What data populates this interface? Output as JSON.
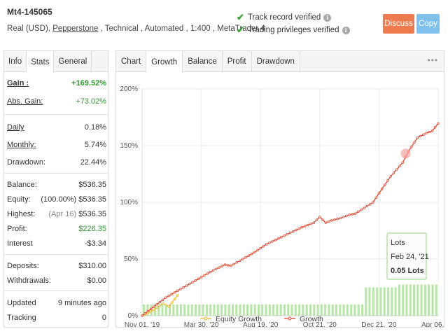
{
  "header": {
    "title": "Mt4-145065",
    "sub_prefix": "Real (USD), ",
    "broker": "Pepperstone",
    "sub_suffix": " , Technical , Automated , 1:400 , MetaTrader 4",
    "verif1": "Track record verified",
    "verif2": "Trading privileges verified",
    "discuss": "Discuss",
    "copy": "Copy",
    "colors": {
      "discuss": "#ee7a4f",
      "copy": "#7fc1ec",
      "check": "#3aa33a"
    }
  },
  "left_tabs": [
    "Info",
    "Stats",
    "General"
  ],
  "stats": {
    "gain": {
      "label": "Gain :",
      "value": "+169.52%"
    },
    "abs_gain": {
      "label": "Abs. Gain:",
      "value": "+73.02%"
    },
    "daily": {
      "label": "Daily",
      "value": "0.18%"
    },
    "monthly": {
      "label": "Monthly:",
      "value": "5.74%"
    },
    "drawdown": {
      "label": "Drawdown:",
      "value": "22.44%"
    },
    "balance": {
      "label": "Balance:",
      "value": "$536.35"
    },
    "equity": {
      "label": "Equity:",
      "note": "(100.00%)",
      "value": "$536.35"
    },
    "highest": {
      "label": "Highest:",
      "note": "(Apr 16)",
      "value": "$536.35"
    },
    "profit": {
      "label": "Profit:",
      "value": "$226.35"
    },
    "interest": {
      "label": "Interest",
      "value": "-$3.34"
    },
    "deposits": {
      "label": "Deposits:",
      "value": "$310.00"
    },
    "withdrawals": {
      "label": "Withdrawals:",
      "value": "$0.00"
    },
    "updated": {
      "label": "Updated",
      "value": "9 minutes ago"
    },
    "tracking": {
      "label": "Tracking",
      "value": "0"
    }
  },
  "right_tabs": [
    "Chart",
    "Growth",
    "Balance",
    "Profit",
    "Drawdown"
  ],
  "more_icon": "ellipsis-icon",
  "chart_data": {
    "type": "line",
    "ylim": [
      0,
      200
    ],
    "yticks": [
      "0%",
      "50%",
      "100%",
      "150%",
      "200%"
    ],
    "xticks": [
      "Nov 01, '19",
      "Mar 30, '20",
      "Aug 19, '20",
      "Oct 21, '20",
      "Dec 21, '20",
      "Apr 06, '21"
    ],
    "series": [
      {
        "name": "Growth",
        "color": "#e0432b",
        "x": [
          0.0,
          0.04,
          0.08,
          0.12,
          0.16,
          0.2,
          0.24,
          0.28,
          0.3,
          0.34,
          0.38,
          0.42,
          0.46,
          0.5,
          0.54,
          0.58,
          0.6,
          0.62,
          0.64,
          0.67,
          0.7,
          0.72,
          0.75,
          0.78,
          0.8,
          0.84,
          0.88,
          0.9,
          0.93,
          0.96,
          0.98,
          1.0
        ],
        "values": [
          0,
          8,
          16,
          22,
          28,
          34,
          40,
          45,
          44,
          50,
          56,
          63,
          68,
          73,
          78,
          82,
          87,
          82,
          84,
          86,
          89,
          90,
          95,
          100,
          108,
          123,
          135,
          145,
          157,
          161,
          163,
          169.5
        ]
      },
      {
        "name": "Equity Growth",
        "color": "#e8b828",
        "x": [
          0.0,
          0.04,
          0.07,
          0.09,
          0.12
        ],
        "values": [
          0,
          5,
          11,
          8,
          18
        ]
      }
    ],
    "lots": {
      "x_start": 0.0,
      "x_end": 1.0,
      "count": 80,
      "low_value": 0.02,
      "high_value": 0.05,
      "switch_at": 0.74,
      "second_switch": 0.86,
      "second_value": 0.055
    },
    "tooltip": {
      "title": "Lots",
      "date": "Feb 24, '21",
      "value": "0.05 Lots"
    },
    "legend": [
      "Equity Growth",
      "Growth"
    ]
  }
}
